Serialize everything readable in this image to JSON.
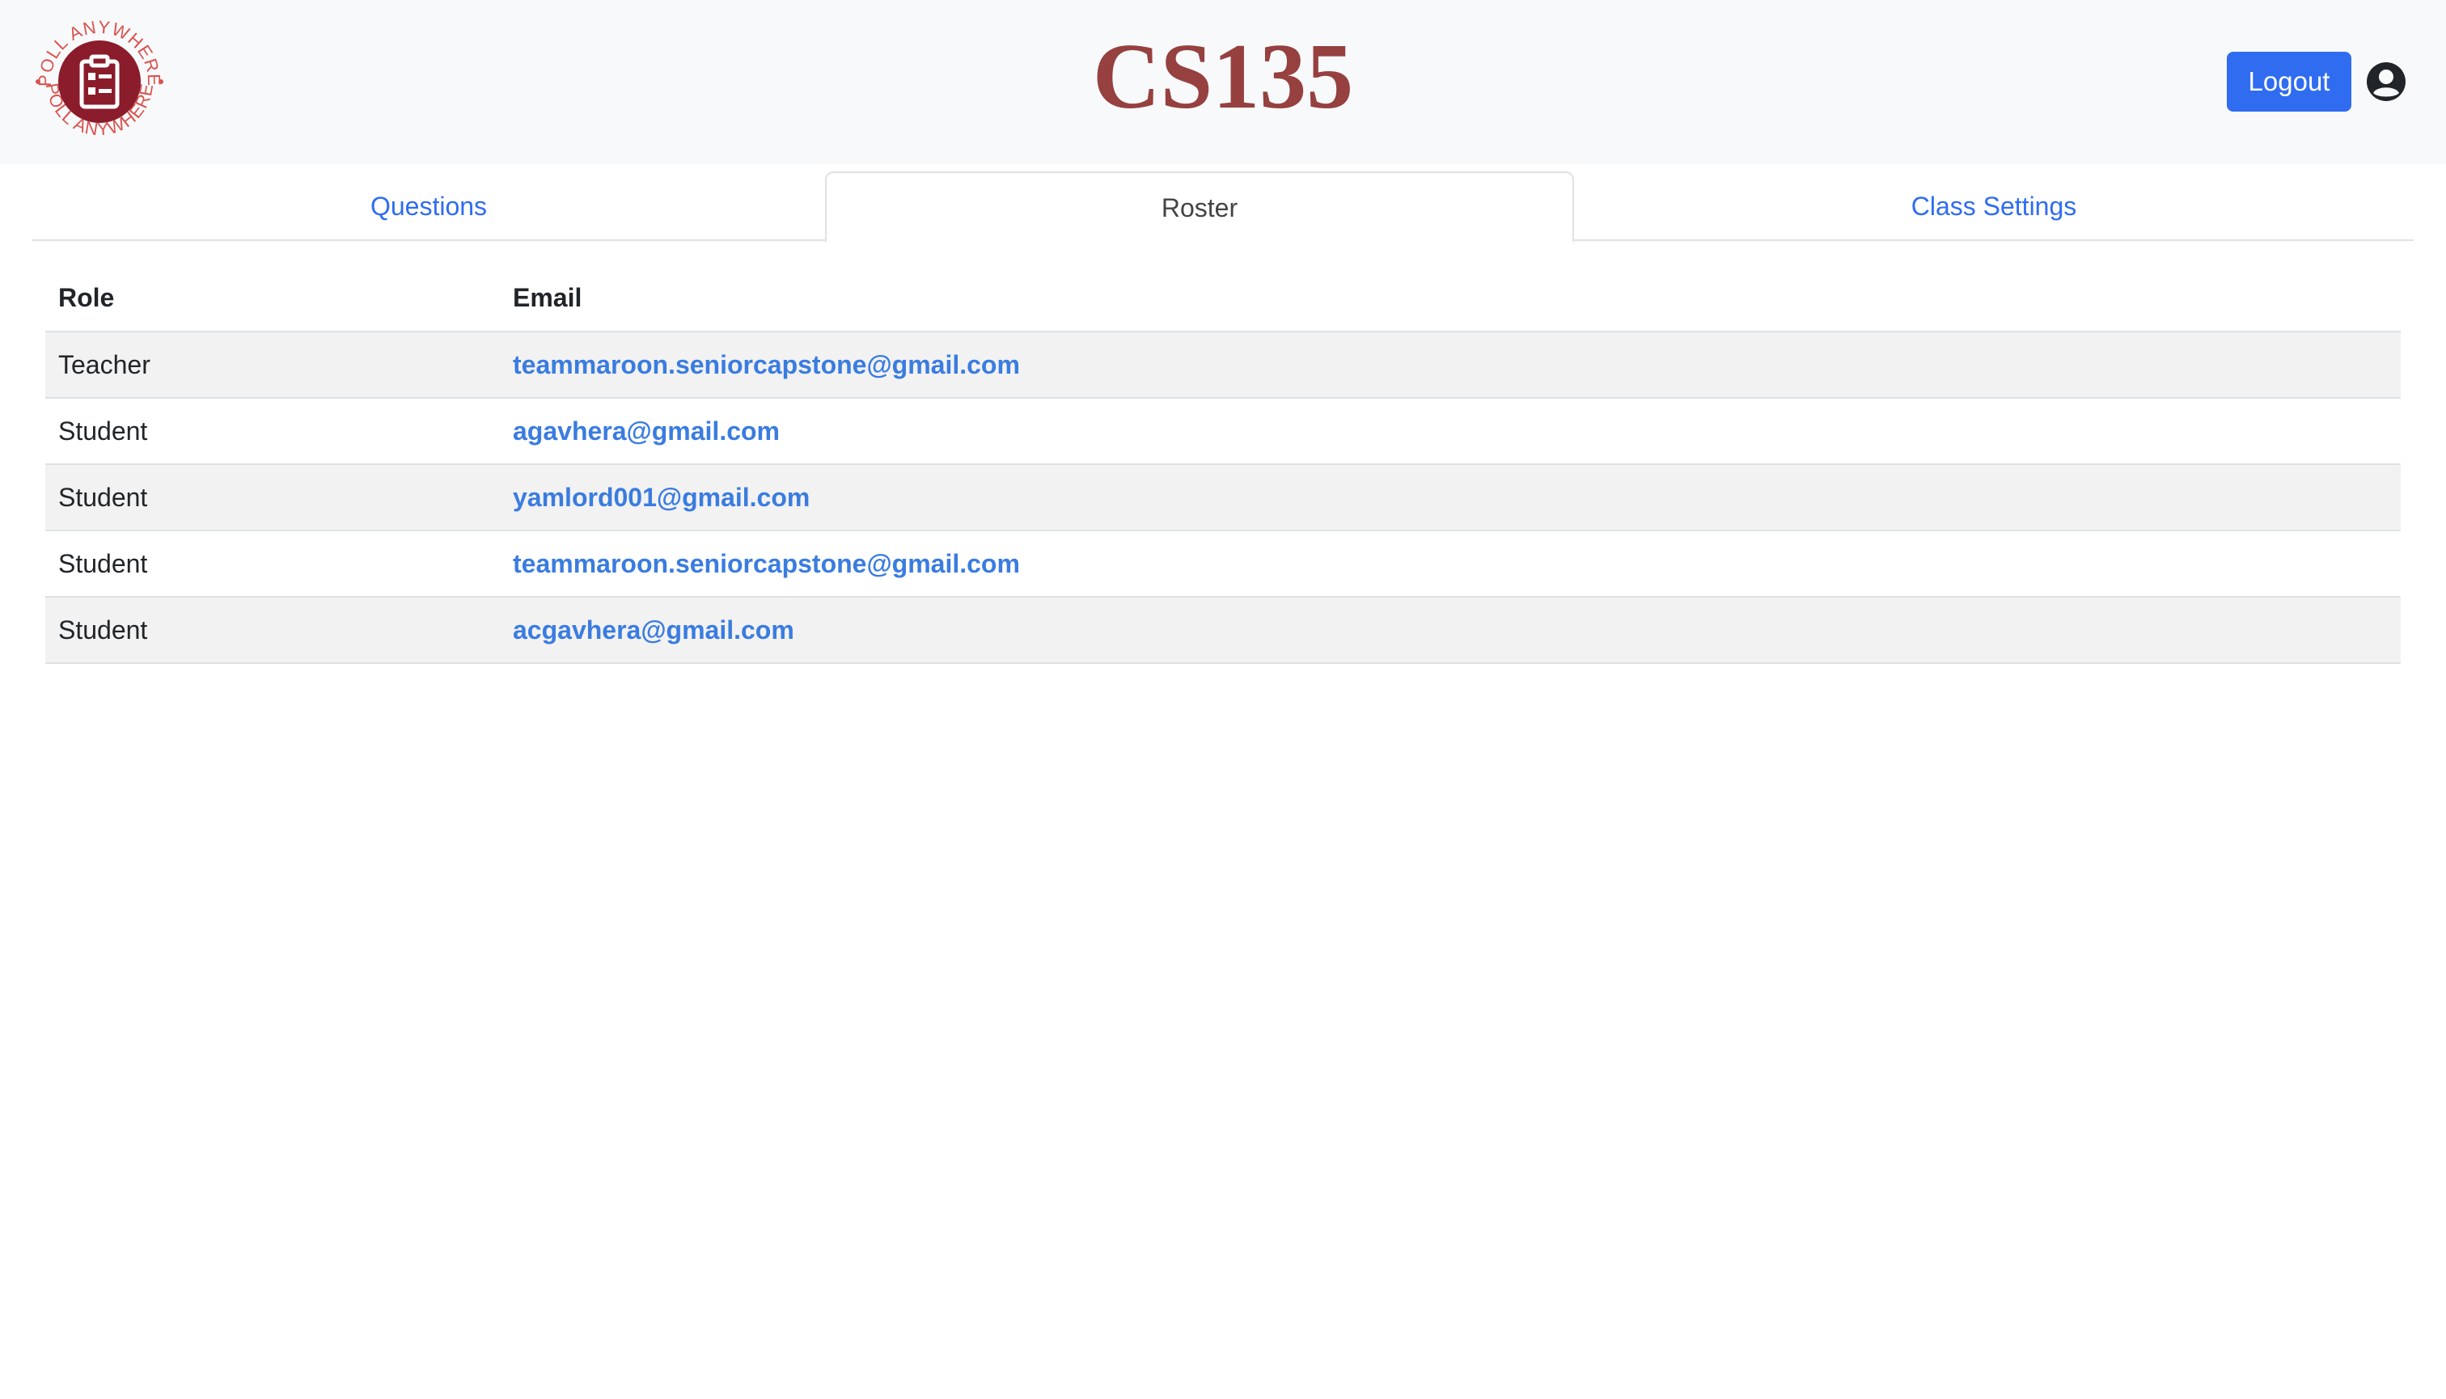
{
  "header": {
    "title": "CS135",
    "logo_text": "POLL ANYWHERE",
    "logout_label": "Logout",
    "colors": {
      "title": "#964040",
      "logo": "#8b1c2b",
      "logout_button": "#2f6cf0",
      "header_bg": "#f8f9fa"
    }
  },
  "tabs": [
    {
      "label": "Questions",
      "active": false
    },
    {
      "label": "Roster",
      "active": true
    },
    {
      "label": "Class Settings",
      "active": false
    }
  ],
  "roster": {
    "columns": [
      "Role",
      "Email"
    ],
    "rows": [
      {
        "role": "Teacher",
        "email": "teammaroon.seniorcapstone@gmail.com"
      },
      {
        "role": "Student",
        "email": "agavhera@gmail.com"
      },
      {
        "role": "Student",
        "email": "yamlord001@gmail.com"
      },
      {
        "role": "Student",
        "email": "teammaroon.seniorcapstone@gmail.com"
      },
      {
        "role": "Student",
        "email": "acgavhera@gmail.com"
      }
    ]
  },
  "icons": {
    "logo": "clipboard-icon",
    "user": "user-circle-icon"
  }
}
